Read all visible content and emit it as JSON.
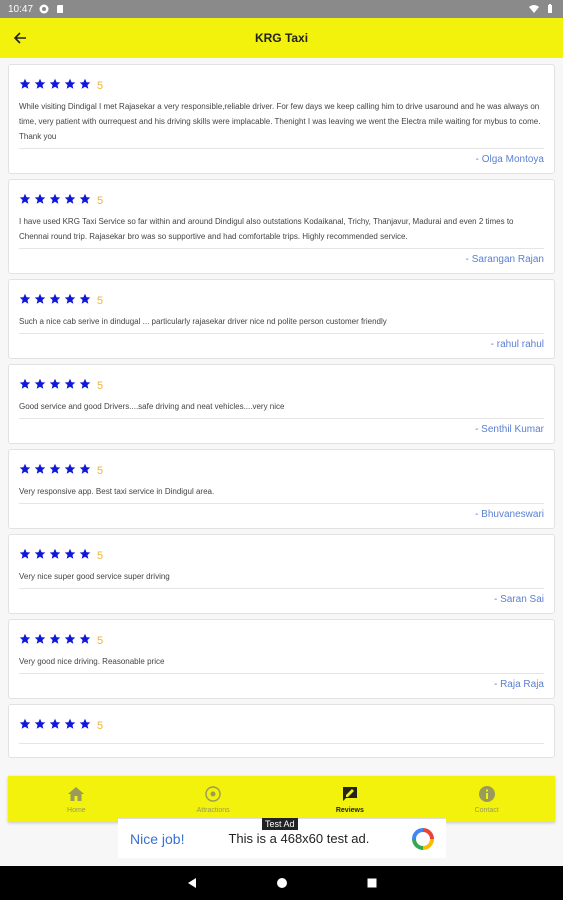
{
  "status_bar": {
    "time": "10:47"
  },
  "app_bar": {
    "title": "KRG Taxi"
  },
  "reviews": [
    {
      "rating": "5",
      "text": "While visiting Dindigal I met Rajasekar a very responsible,reliable driver. For few days we keep calling him to drive usaround and he was always on time, very patient with ourrequest and his driving skills were implacable. Thenight I was leaving we went the Electra mile waiting for mybus to come. Thank you",
      "author": "- Olga Montoya"
    },
    {
      "rating": "5",
      "text": "I have used KRG Taxi Service so far within and around Dindigul also outstations Kodaikanal, Trichy, Thanjavur, Madurai and even 2 times to Chennai round trip. Rajasekar bro was so supportive and had comfortable trips. Highly recommended service.",
      "author": "- Sarangan Rajan"
    },
    {
      "rating": "5",
      "text": "Such a nice cab serive in dindugal ... particularly rajasekar driver nice nd polite person customer friendly",
      "author": "- rahul rahul"
    },
    {
      "rating": "5",
      "text": "Good service and good Drivers....safe driving and neat vehicles....very nice",
      "author": "- Senthil Kumar"
    },
    {
      "rating": "5",
      "text": "Very responsive app. Best taxi service in Dindigul area.",
      "author": "- Bhuvaneswari"
    },
    {
      "rating": "5",
      "text": "Very nice super good service super driving",
      "author": "- Saran Sai"
    },
    {
      "rating": "5",
      "text": "Very good nice driving. Reasonable price",
      "author": "- Raja Raja"
    },
    {
      "rating": "5",
      "text": "",
      "author": ""
    }
  ],
  "bottom_nav": [
    {
      "label": "Home",
      "icon": "home-icon",
      "active": false
    },
    {
      "label": "Attractions",
      "icon": "attractions-icon",
      "active": false
    },
    {
      "label": "Reviews",
      "icon": "reviews-icon",
      "active": true
    },
    {
      "label": "Contact",
      "icon": "info-icon",
      "active": false
    }
  ],
  "ad": {
    "tag": "Test Ad",
    "headline": "Nice job!",
    "body": "This is a 468x60 test ad."
  },
  "colors": {
    "accent": "#f2f20c",
    "star": "#1018d8",
    "rating": "#f0b23c",
    "author": "#5b7fd1"
  }
}
